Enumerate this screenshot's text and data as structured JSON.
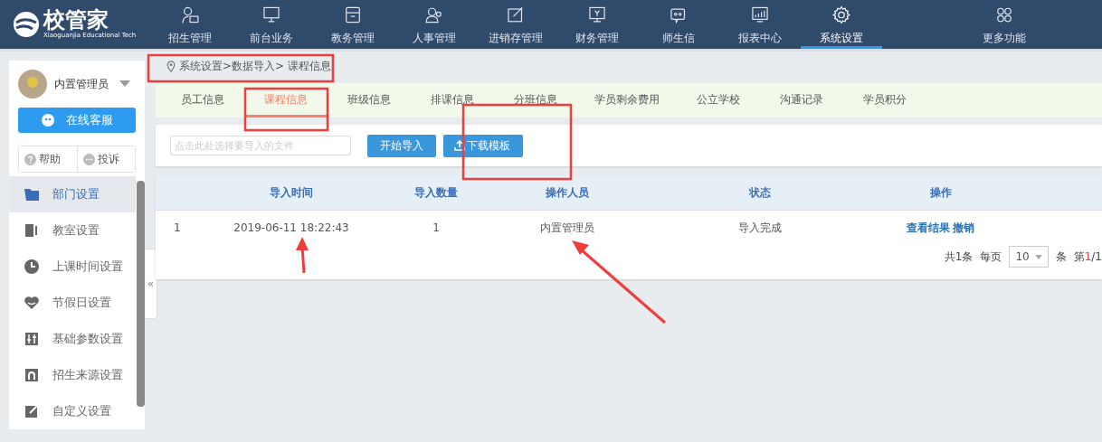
{
  "header": {
    "logo_text": "校管家",
    "logo_subtitle": "Xiaoguanjia Educational Tech",
    "nav": [
      {
        "label": "招生管理",
        "selected": false
      },
      {
        "label": "前台业务",
        "selected": false
      },
      {
        "label": "教务管理",
        "selected": false
      },
      {
        "label": "人事管理",
        "selected": false
      },
      {
        "label": "进销存管理",
        "selected": false
      },
      {
        "label": "财务管理",
        "selected": false
      },
      {
        "label": "师生信",
        "selected": false
      },
      {
        "label": "报表中心",
        "selected": false
      },
      {
        "label": "系统设置",
        "selected": true
      },
      {
        "label": "更多功能",
        "selected": false
      }
    ]
  },
  "collapse_handle": "«",
  "sidebar": {
    "user": "内置管理员",
    "service_button": "在线客服",
    "help": "帮助",
    "complaint": "投诉",
    "items": [
      {
        "label": "部门设置",
        "selected": true
      },
      {
        "label": "教室设置",
        "selected": false
      },
      {
        "label": "上课时间设置",
        "selected": false
      },
      {
        "label": "节假日设置",
        "selected": false
      },
      {
        "label": "基础参数设置",
        "selected": false
      },
      {
        "label": "招生来源设置",
        "selected": false
      },
      {
        "label": "自定义设置",
        "selected": false
      }
    ]
  },
  "breadcrumb": "系统设置>数据导入> 课程信息",
  "tabs": [
    {
      "label": "员工信息",
      "selected": false
    },
    {
      "label": "课程信息",
      "selected": true
    },
    {
      "label": "班级信息",
      "selected": false
    },
    {
      "label": "排课信息",
      "selected": false
    },
    {
      "label": "分班信息",
      "selected": false
    },
    {
      "label": "学员剩余费用",
      "selected": false
    },
    {
      "label": "公立学校",
      "selected": false
    },
    {
      "label": "沟通记录",
      "selected": false
    },
    {
      "label": "学员积分",
      "selected": false
    }
  ],
  "import_bar": {
    "placeholder": "点击此处选择要导入的文件",
    "start_button": "开始导入",
    "download_button": "下载模板"
  },
  "table": {
    "columns": [
      "",
      "导入时间",
      "导入数量",
      "操作人员",
      "状态",
      "操作"
    ],
    "rows": [
      {
        "cells": [
          "1",
          "2019-06-11 18:22:43",
          "1",
          "内置管理员",
          "导入完成"
        ],
        "actions": [
          "查看结果",
          "撤销"
        ]
      }
    ]
  },
  "pagination": {
    "total": "共1条",
    "per_page_label": "每页",
    "per_page": "10",
    "unit": "条",
    "page_prefix": "第",
    "page_current": "1",
    "page_suffix": "/1"
  }
}
